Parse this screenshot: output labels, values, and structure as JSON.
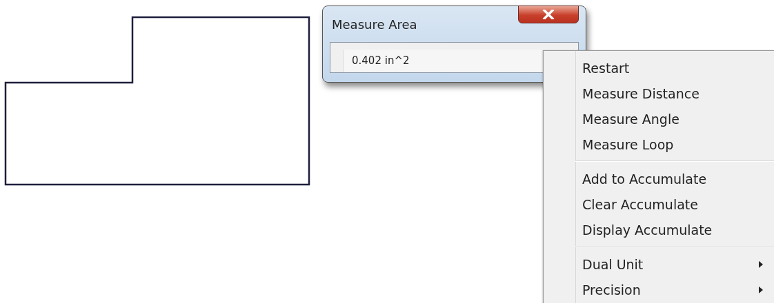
{
  "dialog": {
    "title": "Measure Area",
    "value": "0.402 in^2"
  },
  "context_menu": {
    "items": [
      {
        "kind": "item",
        "label": "Restart",
        "submenu": false
      },
      {
        "kind": "item",
        "label": "Measure Distance",
        "submenu": false
      },
      {
        "kind": "item",
        "label": "Measure Angle",
        "submenu": false
      },
      {
        "kind": "item",
        "label": "Measure Loop",
        "submenu": false
      },
      {
        "kind": "separator"
      },
      {
        "kind": "item",
        "label": "Add to Accumulate",
        "submenu": false
      },
      {
        "kind": "item",
        "label": "Clear Accumulate",
        "submenu": false
      },
      {
        "kind": "item",
        "label": "Display Accumulate",
        "submenu": false
      },
      {
        "kind": "separator"
      },
      {
        "kind": "item",
        "label": "Dual Unit",
        "submenu": true
      },
      {
        "kind": "item",
        "label": "Precision",
        "submenu": true
      }
    ]
  }
}
